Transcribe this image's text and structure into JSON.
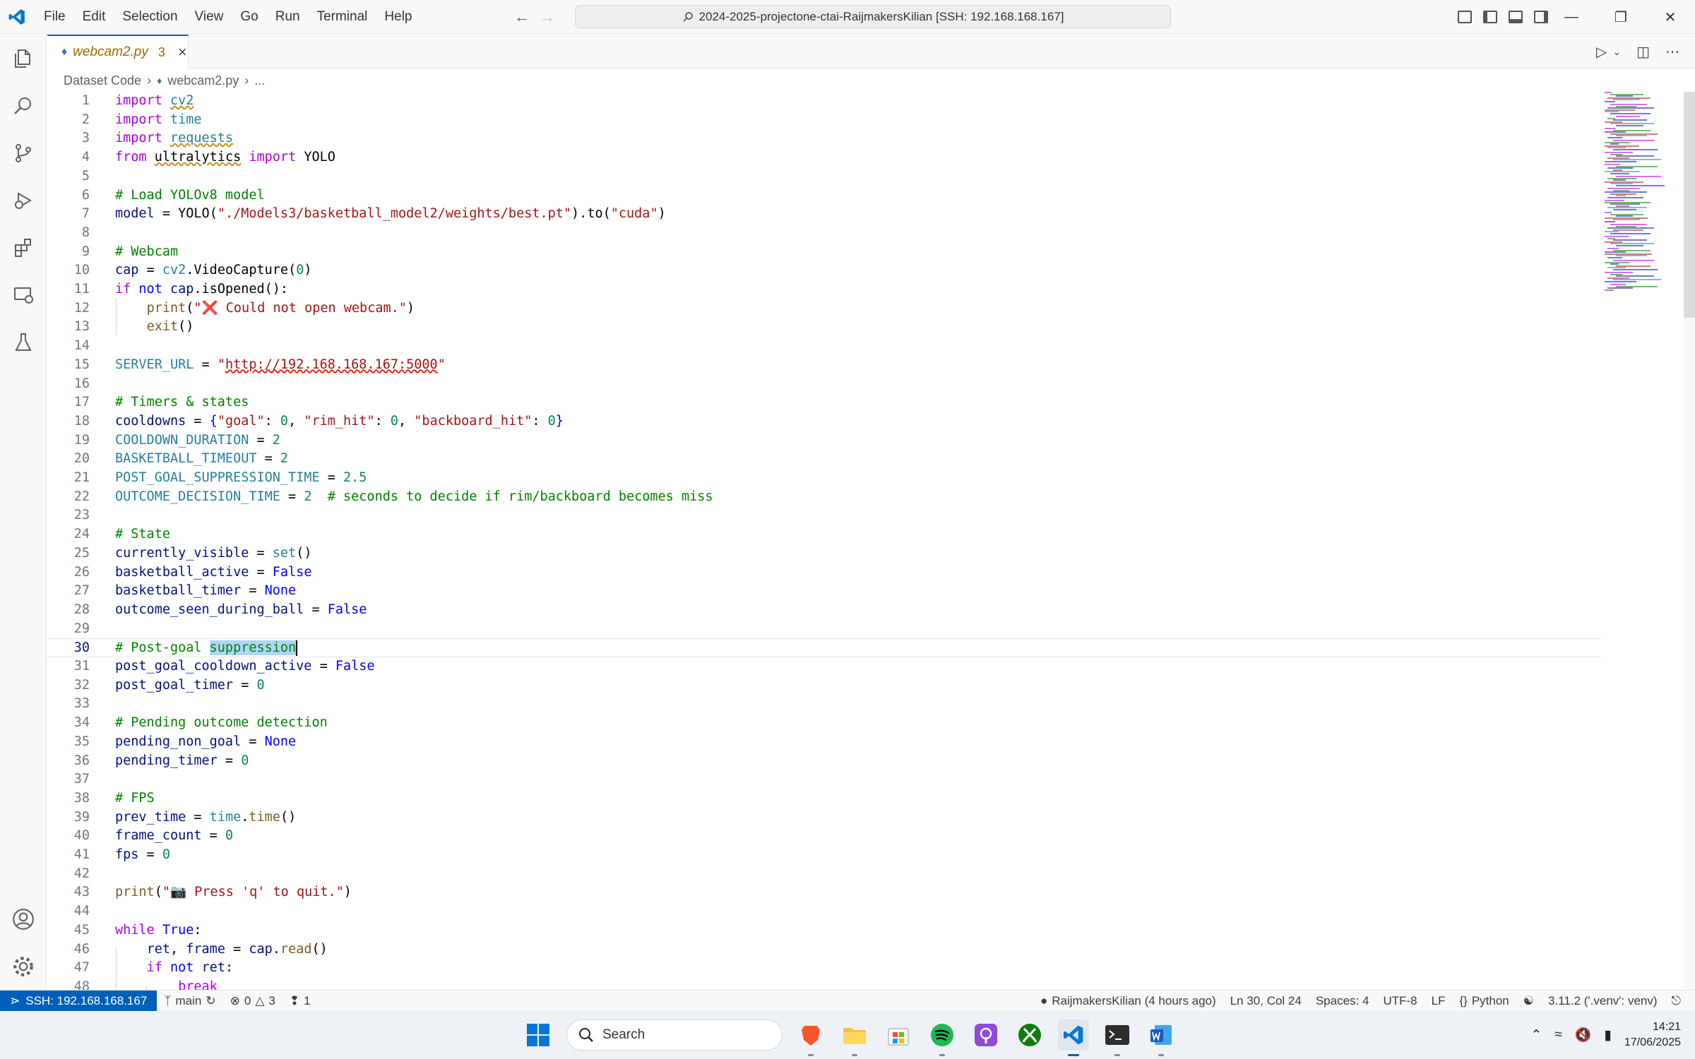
{
  "menu": [
    "File",
    "Edit",
    "Selection",
    "View",
    "Go",
    "Run",
    "Terminal",
    "Help"
  ],
  "command_center": "2024-2025-projectone-ctai-RaijmakersKilian [SSH: 192.168.168.167]",
  "tab": {
    "name": "webcam2.py",
    "problems": "3"
  },
  "breadcrumb": {
    "folder": "Dataset Code",
    "file": "webcam2.py",
    "more": "..."
  },
  "editor": {
    "current_line": 30,
    "lines": [
      {
        "n": 1
      },
      {
        "n": 2
      },
      {
        "n": 3
      },
      {
        "n": 4
      },
      {
        "n": 5
      },
      {
        "n": 6
      },
      {
        "n": 7
      },
      {
        "n": 8
      },
      {
        "n": 9
      },
      {
        "n": 10
      },
      {
        "n": 11
      },
      {
        "n": 12
      },
      {
        "n": 13
      },
      {
        "n": 14
      },
      {
        "n": 15
      },
      {
        "n": 16
      },
      {
        "n": 17
      },
      {
        "n": 18
      },
      {
        "n": 19
      },
      {
        "n": 20
      },
      {
        "n": 21
      },
      {
        "n": 22
      },
      {
        "n": 23
      },
      {
        "n": 24
      },
      {
        "n": 25
      },
      {
        "n": 26
      },
      {
        "n": 27
      },
      {
        "n": 28
      },
      {
        "n": 29
      },
      {
        "n": 30
      },
      {
        "n": 31
      },
      {
        "n": 32
      },
      {
        "n": 33
      },
      {
        "n": 34
      },
      {
        "n": 35
      },
      {
        "n": 36
      },
      {
        "n": 37
      },
      {
        "n": 38
      },
      {
        "n": 39
      },
      {
        "n": 40
      },
      {
        "n": 41
      },
      {
        "n": 42
      },
      {
        "n": 43
      },
      {
        "n": 44
      },
      {
        "n": 45
      },
      {
        "n": 46
      },
      {
        "n": 47
      },
      {
        "n": 48
      }
    ],
    "code": {
      "l1": [
        "import",
        "cv2"
      ],
      "l2": [
        "import",
        "time"
      ],
      "l3": [
        "import",
        "requests"
      ],
      "l4": [
        "from",
        "ultralytics",
        "import",
        "YOLO"
      ],
      "l6": "# Load YOLOv8 model",
      "l7": [
        "model",
        " = ",
        "YOLO",
        "(",
        "\"./Models3/basketball_model2/weights/best.pt\"",
        ").",
        "to",
        "(",
        "\"cuda\"",
        ")"
      ],
      "l9": "# Webcam",
      "l10": [
        "cap",
        " = ",
        "cv2",
        ".",
        "VideoCapture",
        "(",
        "0",
        ")"
      ],
      "l11": [
        "if",
        "not",
        "cap",
        ".",
        "isOpened",
        "():"
      ],
      "l12": [
        "print",
        "(",
        "\"❌ Could not open webcam.\"",
        ")"
      ],
      "l13": [
        "exit",
        "()"
      ],
      "l15": [
        "SERVER_URL",
        " = ",
        "\"",
        "http://192.168.168.167:5000",
        "\""
      ],
      "l17": "# Timers & states",
      "l18": [
        "cooldowns",
        " = ",
        "{",
        "\"goal\"",
        ": ",
        "0",
        ", ",
        "\"rim_hit\"",
        ": ",
        "0",
        ", ",
        "\"backboard_hit\"",
        ": ",
        "0",
        "}"
      ],
      "l19": [
        "COOLDOWN_DURATION",
        " = ",
        "2"
      ],
      "l20": [
        "BASKETBALL_TIMEOUT",
        " = ",
        "2"
      ],
      "l21": [
        "POST_GOAL_SUPPRESSION_TIME",
        " = ",
        "2.5"
      ],
      "l22": [
        "OUTCOME_DECISION_TIME",
        " = ",
        "2",
        "  # seconds to decide if rim/backboard becomes miss"
      ],
      "l24": "# State",
      "l25": [
        "currently_visible",
        " = ",
        "set",
        "()"
      ],
      "l26": [
        "basketball_active",
        " = ",
        "False"
      ],
      "l27": [
        "basketball_timer",
        " = ",
        "None"
      ],
      "l28": [
        "outcome_seen_during_ball",
        " = ",
        "False"
      ],
      "l30": [
        "# Post-goal ",
        "suppression"
      ],
      "l31": [
        "post_goal_cooldown_active",
        " = ",
        "False"
      ],
      "l32": [
        "post_goal_timer",
        " = ",
        "0"
      ],
      "l34": "# Pending outcome detection",
      "l35": [
        "pending_non_goal",
        " = ",
        "None"
      ],
      "l36": [
        "pending_timer",
        " = ",
        "0"
      ],
      "l38": "# FPS",
      "l39": [
        "prev_time",
        " = ",
        "time",
        ".",
        "time",
        "()"
      ],
      "l40": [
        "frame_count",
        " = ",
        "0"
      ],
      "l41": [
        "fps",
        " = ",
        "0"
      ],
      "l43": [
        "print",
        "(",
        "\"📷 Press 'q' to quit.\"",
        ")"
      ],
      "l45": [
        "while",
        "True",
        ":"
      ],
      "l46": [
        "ret",
        ", ",
        "frame",
        " = ",
        "cap",
        ".",
        "read",
        "()"
      ],
      "l47": [
        "if",
        "not",
        "ret",
        ":"
      ],
      "l48": [
        "break"
      ]
    }
  },
  "statusbar": {
    "remote": "SSH: 192.168.168.167",
    "branch": "main",
    "errors": "0",
    "warnings": "3",
    "ports": "1",
    "blame": "RaijmakersKilian (4 hours ago)",
    "position": "Ln 30, Col 24",
    "spaces": "Spaces: 4",
    "encoding": "UTF-8",
    "eol": "LF",
    "language": "Python",
    "interpreter": "3.11.2 ('.venv': venv)"
  },
  "taskbar": {
    "search": "Search",
    "time": "14:21",
    "date": "17/06/2025"
  },
  "colors": {
    "accent": "#005fb8",
    "keyword": "#af00db",
    "string": "#a31515",
    "comment": "#008000",
    "number": "#098658"
  }
}
